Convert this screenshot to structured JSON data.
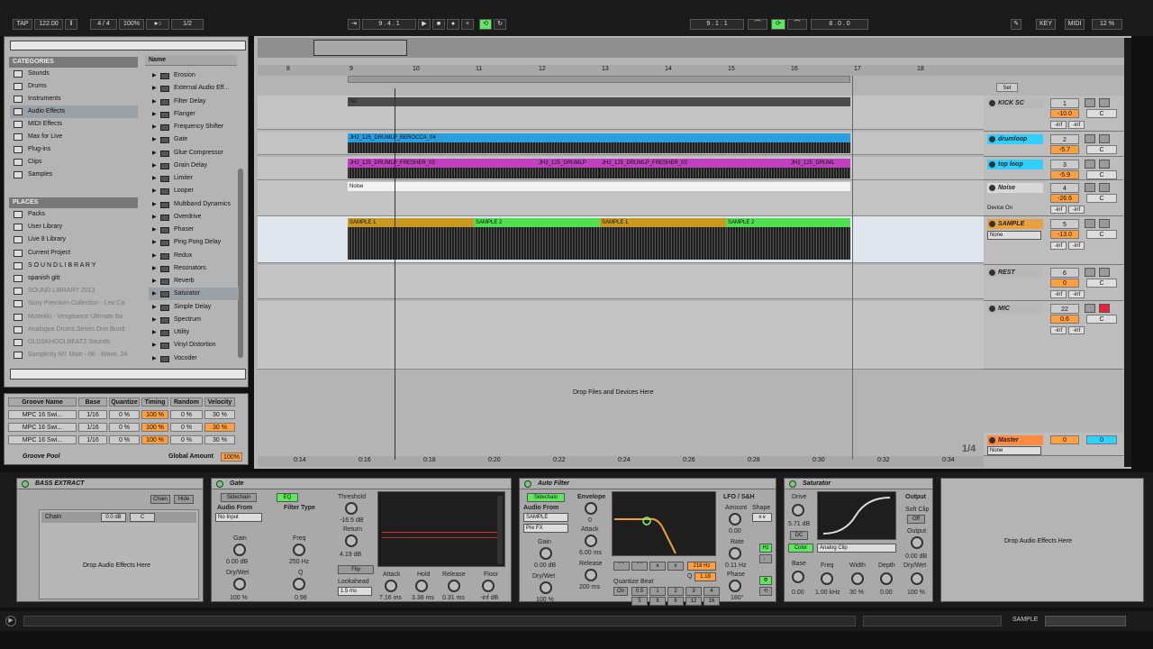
{
  "transport": {
    "tap": "TAP",
    "tempo": "122.00",
    "sig": "4 / 4",
    "zoom": "100%",
    "quant": "1/2",
    "pos": "9 . 4 . 1",
    "loop_start": "9 . 1 . 1",
    "loop_len": "8 . 0 . 0",
    "key": "KEY",
    "midi": "MIDI",
    "cpu": "12 %"
  },
  "browser": {
    "categories_hdr": "CATEGORIES",
    "categories": [
      "Sounds",
      "Drums",
      "Instruments",
      "Audio Effects",
      "MIDI Effects",
      "Max for Live",
      "Plug-ins",
      "Clips",
      "Samples"
    ],
    "places_hdr": "PLACES",
    "places": [
      "Packs",
      "User Library",
      "Live 8 Library",
      "Current Project",
      "S O U N D L I B R A R Y",
      "spanish gitt",
      "SOUND LIBRARY 2013",
      "Sony Premium Collection - Leo Ca",
      "Muttekki - Vengeance Ultimate Ba",
      "Analogue.Drums.Series.One.Bund",
      "OLDSKHOOLBEATZ Sounds",
      "Samplicity M7 Main - 06 - Wave, 24"
    ],
    "name_hdr": "Name",
    "effects": [
      "Erosion",
      "External Audio Eff...",
      "Filter Delay",
      "Flanger",
      "Frequency Shifter",
      "Gate",
      "Glue Compressor",
      "Grain Delay",
      "Limiter",
      "Looper",
      "Multiband Dynamics",
      "Overdrive",
      "Phaser",
      "Ping Pong Delay",
      "Redux",
      "Resonators",
      "Reverb",
      "Saturator",
      "Simple Delay",
      "Spectrum",
      "Utility",
      "Vinyl Distortion",
      "Vocoder"
    ]
  },
  "groove": {
    "headers": [
      "Groove Name",
      "Base",
      "Quantize",
      "Timing",
      "Random",
      "Velocity"
    ],
    "rows": [
      [
        "MPC 16 Swi...",
        "1/16",
        "0 %",
        "100 %",
        "0 %",
        "30 %"
      ],
      [
        "MPC 16 Swi...",
        "1/16",
        "0 %",
        "100 %",
        "0 %",
        "30 %"
      ],
      [
        "MPC 16 Swi...",
        "1/16",
        "0 %",
        "100 %",
        "0 %",
        "30 %"
      ]
    ],
    "pool": "Groove Pool",
    "global_label": "Global Amount",
    "global_value": "100%"
  },
  "arrangement": {
    "bars": [
      "8",
      "9",
      "10",
      "11",
      "12",
      "13",
      "14",
      "15",
      "16",
      "17",
      "18"
    ],
    "times": [
      "0:14",
      "0:16",
      "0:18",
      "0:20",
      "0:22",
      "0:24",
      "0:26",
      "0:28",
      "0:30",
      "0:32",
      "0:34"
    ],
    "clips": {
      "sc": "SC",
      "berocca": "JH2_125_DRUMLP_BEROCCA_04",
      "fresher1": "JH2_125_DRUMLP_FRESHER_03",
      "fresher2": "JH2_125_DRUMLP",
      "fresher3": "JH2_125_DRUMLP_FRESHER_03",
      "fresher4": "JH2_125_DRUML",
      "noise": "Noise",
      "s1a": "SAMPLE 1",
      "s2a": "SAMPLE 2",
      "s1b": "SAMPLE 1",
      "s2b": "SAMPLE 2"
    },
    "drop": "Drop Files and Devices Here",
    "page": "1/4",
    "set": "Set"
  },
  "tracks": [
    {
      "name": "KICK SC",
      "num": "1",
      "vol": "-10.0",
      "pan": "C",
      "color": "#b8b8b8"
    },
    {
      "name": "drumloop",
      "num": "2",
      "vol": "-5.7",
      "pan": "C",
      "color": "#2fd0ff"
    },
    {
      "name": "top loop",
      "num": "3",
      "vol": "-5.9",
      "pan": "C",
      "color": "#2fd0ff"
    },
    {
      "name": "Noise",
      "num": "4",
      "vol": "-26.6",
      "pan": "C",
      "color": "#d8d8d8",
      "extra": "Device On"
    },
    {
      "name": "SAMPLE",
      "num": "5",
      "vol": "-13.0",
      "pan": "C",
      "color": "#e8a040",
      "sel": "None"
    },
    {
      "name": "REST",
      "num": "6",
      "vol": "0",
      "pan": "C",
      "color": "#b8b8b8"
    },
    {
      "name": "MIC",
      "num": "22",
      "vol": "0.6",
      "pan": "C",
      "color": "#b8b8b8"
    }
  ],
  "master": {
    "name": "Master",
    "vol": "0",
    "pan": "0",
    "sel": "None"
  },
  "inf": "-inf",
  "devices": {
    "bass": {
      "title": "BASS EXTRACT",
      "chain_btn": "Chain",
      "hide_btn": "Hide",
      "chain": "Chain",
      "chain_db": "0.0 dB",
      "chain_pan": "C",
      "drop": "Drop Audio Effects Here"
    },
    "gate": {
      "title": "Gate",
      "sidechain": "Sidechain",
      "eq": "EQ",
      "audio_from": "Audio From",
      "no_input": "No Input",
      "gain": "Gain",
      "gain_v": "0.00 dB",
      "drywet": "Dry/Wet",
      "drywet_v": "100 %",
      "filter_type": "Filter Type",
      "freq": "Freq",
      "freq_v": "250 Hz",
      "q": "Q",
      "q_v": "0.98",
      "threshold": "Threshold",
      "threshold_v": "-16.5 dB",
      "return": "Return",
      "return_v": "4.19 dB",
      "flip": "Flip",
      "lookahead": "Lookahead",
      "lookahead_v": "1.5 ms",
      "attack": "Attack",
      "attack_v": "7.16 ms",
      "hold": "Hold",
      "hold_v": "3.38 ms",
      "release": "Release",
      "release_v": "0.31 ms",
      "floor": "Floor",
      "floor_v": "-inf dB"
    },
    "filter": {
      "title": "Auto Filter",
      "sidechain": "Sidechain",
      "audio_from": "Audio From",
      "sample": "SAMPLE",
      "prefx": "Pre FX",
      "gain": "Gain",
      "gain_v": "0.00 dB",
      "drywet": "Dry/Wet",
      "drywet_v": "100 %",
      "envelope": "Envelope",
      "env_v": "0",
      "attack": "Attack",
      "attack_v": "6.00 ms",
      "release": "Release",
      "release_v": "200 ms",
      "freq_v": "218 Hz",
      "q": "Q",
      "q_v": "1.18",
      "quantize": "Quantize Beat",
      "on": "On",
      "beats": [
        "0.5",
        "1",
        "2",
        "3",
        "4",
        "5",
        "6",
        "8",
        "12",
        "16"
      ],
      "lfo": "LFO / S&H",
      "shape": "Shape",
      "amount": "Amount",
      "amount_v": "0.00",
      "rate": "Rate",
      "rate_v": "0.11 Hz",
      "phase": "Phase",
      "phase_v": "180°"
    },
    "sat": {
      "title": "Saturator",
      "drive": "Drive",
      "drive_v": "5.71 dB",
      "dc": "DC",
      "color": "Color",
      "analog": "Analog Clip",
      "output": "Output",
      "soft_clip": "Soft Clip",
      "off": "Off",
      "output_v": "0.00 dB",
      "drywet": "Dry/Wet",
      "drywet_v": "100 %",
      "base": "Base",
      "base_v": "0.00",
      "freq": "Freq",
      "freq_v": "1.00 kHz",
      "width": "Width",
      "width_v": "30 %",
      "depth": "Depth",
      "depth_v": "0.00"
    },
    "drop": "Drop Audio Effects Here"
  },
  "status": {
    "track": "SAMPLE"
  }
}
